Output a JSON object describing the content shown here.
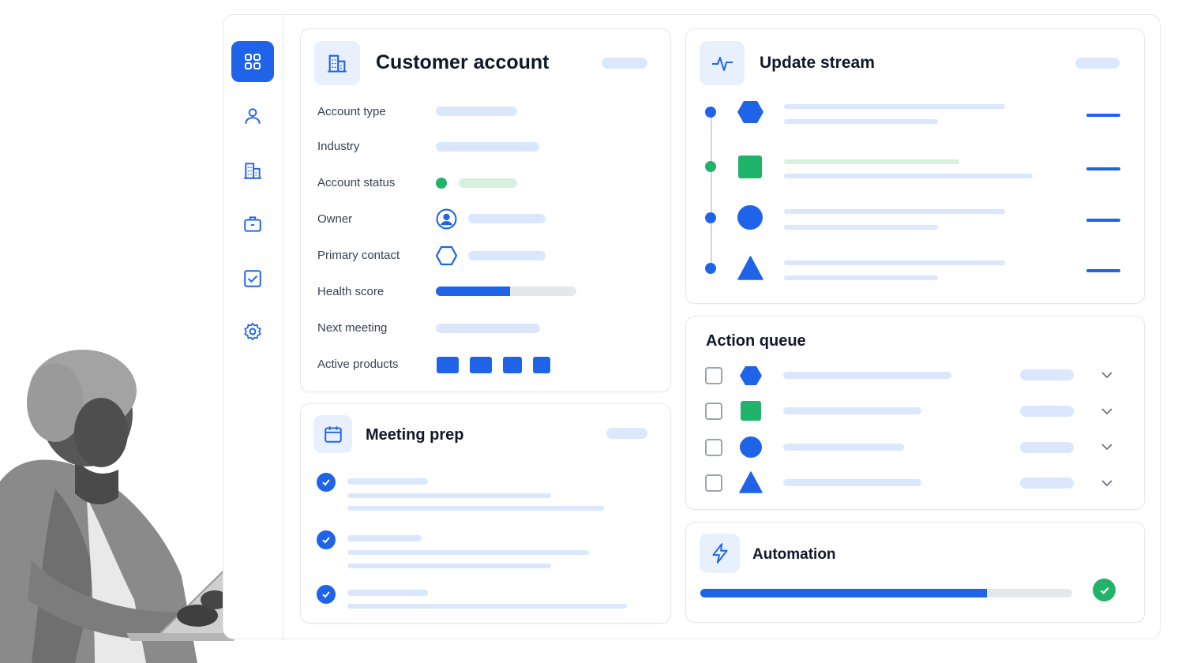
{
  "sidebar": {
    "items": [
      {
        "icon": "grid-icon",
        "active": true
      },
      {
        "icon": "user-icon"
      },
      {
        "icon": "building-icon"
      },
      {
        "icon": "briefcase-icon"
      },
      {
        "icon": "checkbox-icon"
      },
      {
        "icon": "gear-icon"
      }
    ]
  },
  "customer_account": {
    "title": "Customer account",
    "icon": "building-icon",
    "fields": {
      "account_type": "Account type",
      "industry": "Industry",
      "account_status": "Account status",
      "owner": "Owner",
      "primary_contact": "Primary contact",
      "health_score": "Health score",
      "next_meeting": "Next meeting",
      "active_products": "Active products"
    },
    "health_score_fraction": 0.53,
    "active_products_count": 4
  },
  "update_stream": {
    "title": "Update stream",
    "icon": "activity-icon",
    "items": [
      {
        "marker": "blue",
        "shape": "hexagon-icon"
      },
      {
        "marker": "green",
        "shape": "square-icon"
      },
      {
        "marker": "blue",
        "shape": "circle-icon"
      },
      {
        "marker": "blue",
        "shape": "triangle-icon"
      }
    ]
  },
  "action_queue": {
    "title": "Action queue",
    "items": [
      {
        "shape": "hexagon-icon",
        "checked": false
      },
      {
        "shape": "square-icon",
        "checked": false
      },
      {
        "shape": "circle-icon",
        "checked": false
      },
      {
        "shape": "triangle-icon",
        "checked": false
      }
    ]
  },
  "meeting_prep": {
    "title": "Meeting prep",
    "icon": "calendar-icon",
    "items_completed": 3
  },
  "automation": {
    "title": "Automation",
    "icon": "lightning-icon",
    "progress_fraction": 0.77,
    "status_icon": "check-circle-icon"
  },
  "colors": {
    "accent": "#1f63e8",
    "accent_light": "#dbe7fd",
    "success": "#22b36b",
    "success_light": "#d6f1df",
    "border": "#e5e7eb"
  }
}
